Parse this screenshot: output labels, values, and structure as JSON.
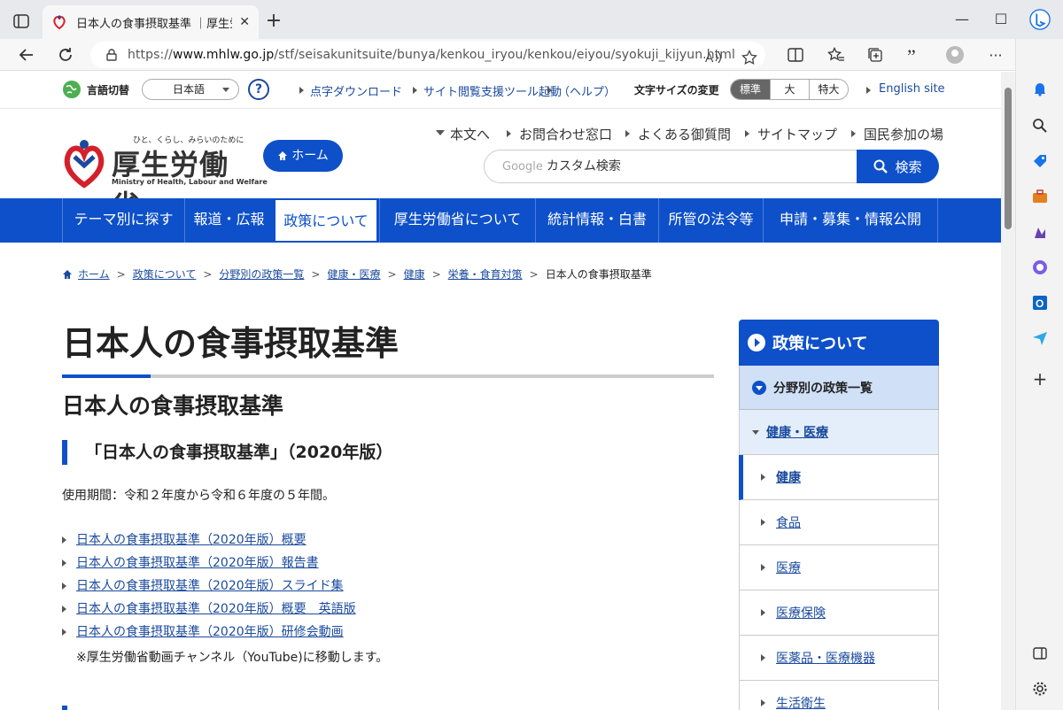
{
  "browser": {
    "tab_title": "日本人の食事摂取基準 ｜厚生労働省",
    "url_prefix": "https://",
    "url_host": "www.mhlw.go.jp",
    "url_path": "/stf/seisakunitsuite/bunya/kenkou_iryou/kenkou/eiyou/syokuji_kijyun.html"
  },
  "util": {
    "lang_label": "言語切替",
    "lang_value": "日本語",
    "help": "?",
    "links": [
      "点字ダウンロード",
      "サイト閲覧支援ツール起動",
      "（ヘルプ）"
    ],
    "fontsize_label": "文字サイズの変更",
    "fontsizes": [
      "標準",
      "大",
      "特大"
    ],
    "english": "English site"
  },
  "header": {
    "logo_tagline": "ひと、くらし、みらいのために",
    "logo_name": "厚生労働省",
    "logo_en": "Ministry of Health, Labour and Welfare",
    "home": "ホーム",
    "links": [
      "本文へ",
      "お問合わせ窓口",
      "よくある御質問",
      "サイトマップ",
      "国民参加の場"
    ],
    "search_google": "Google",
    "search_placeholder": "カスタム検索",
    "search_button": "検索"
  },
  "gnav": [
    "テーマ別に探す",
    "報道・広報",
    "政策について",
    "厚生労働省について",
    "統計情報・白書",
    "所管の法令等",
    "申請・募集・情報公開"
  ],
  "breadcrumb": [
    "ホーム",
    "政策について",
    "分野別の政策一覧",
    "健康・医療",
    "健康",
    "栄養・食育対策",
    "日本人の食事摂取基準"
  ],
  "breadcrumb_sep": ">",
  "main": {
    "title": "日本人の食事摂取基準",
    "subtitle": "日本人の食事摂取基準",
    "section": "「日本人の食事摂取基準」（2020年版）",
    "period": "使用期間：令和２年度から令和６年度の５年間。",
    "docs": [
      "日本人の食事摂取基準（2020年版）概要",
      "日本人の食事摂取基準（2020年版）報告書",
      "日本人の食事摂取基準（2020年版）スライド集",
      "日本人の食事摂取基準（2020年版）概要　英語版",
      "日本人の食事摂取基準（2020年版）研修会動画"
    ],
    "note": "※厚生労働省動画チャンネル（YouTube)に移動します。"
  },
  "side": {
    "head": "政策について",
    "sub": "分野別の政策一覧",
    "category": "健康・医療",
    "items": [
      "健康",
      "食品",
      "医療",
      "医療保険",
      "医薬品・医療機器",
      "生活衛生"
    ]
  },
  "colors": {
    "primary": "#0e50c9",
    "link": "#1a4a9e"
  }
}
